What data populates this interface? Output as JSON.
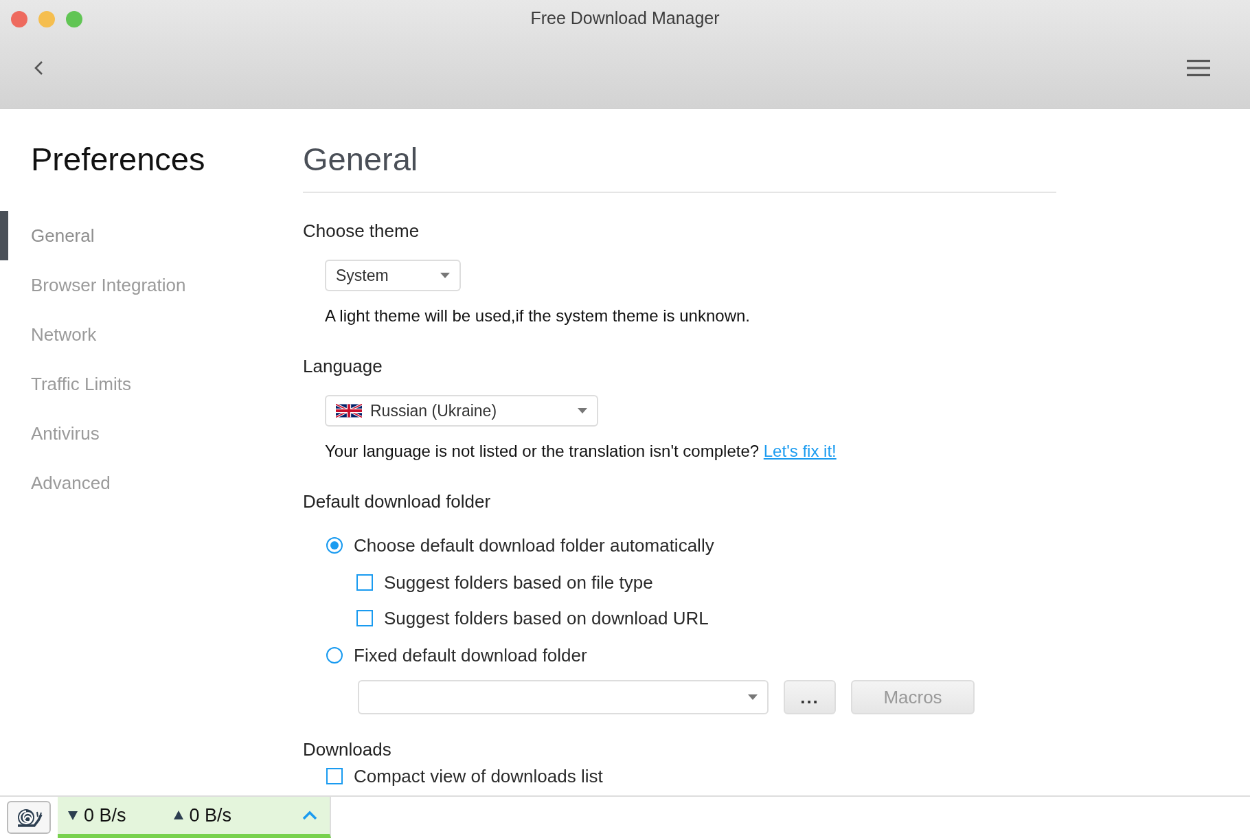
{
  "window": {
    "title": "Free Download Manager"
  },
  "sidebar": {
    "title": "Preferences",
    "items": [
      {
        "label": "General",
        "selected": true
      },
      {
        "label": "Browser Integration",
        "selected": false
      },
      {
        "label": "Network",
        "selected": false
      },
      {
        "label": "Traffic Limits",
        "selected": false
      },
      {
        "label": "Antivirus",
        "selected": false
      },
      {
        "label": "Advanced",
        "selected": false
      }
    ]
  },
  "page": {
    "title": "General",
    "theme": {
      "label": "Choose theme",
      "value": "System",
      "hint": "A light theme will be used,if the system theme is unknown."
    },
    "language": {
      "label": "Language",
      "value": "Russian (Ukraine)",
      "hint": "Your language is not listed or the translation isn't complete?",
      "link": "Let's fix it!"
    },
    "download_folder": {
      "label": "Default download folder",
      "options": [
        {
          "kind": "radio",
          "label": "Choose default download folder automatically",
          "selected": true,
          "children": [
            {
              "kind": "checkbox",
              "label": "Suggest folders based on file type",
              "checked": false
            },
            {
              "kind": "checkbox",
              "label": "Suggest folders based on download URL",
              "checked": false
            }
          ]
        },
        {
          "kind": "radio",
          "label": "Fixed default download folder",
          "selected": false
        }
      ],
      "browse_button": "...",
      "macros_button": {
        "label": "Macros",
        "disabled": true
      }
    },
    "downloads": {
      "label": "Downloads",
      "options": [
        {
          "kind": "checkbox",
          "label": "Compact view of downloads list",
          "checked": false
        }
      ]
    }
  },
  "status_bar": {
    "download_speed": "0 B/s",
    "upload_speed": "0 B/s"
  }
}
